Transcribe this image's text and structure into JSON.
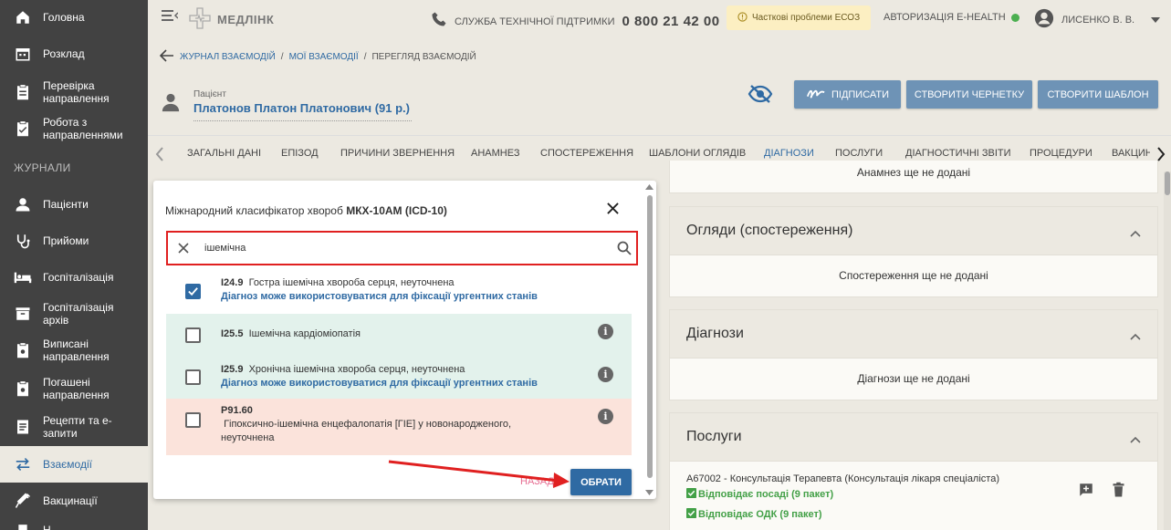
{
  "sidebar": {
    "items": [
      {
        "label": "Головна",
        "icon": "home-icon"
      },
      {
        "label": "Розклад",
        "icon": "calendar-icon"
      },
      {
        "label": "Перевірка направлення",
        "icon": "clipboard-icon"
      },
      {
        "label": "Робота з направленнями",
        "icon": "clipboard-check-icon"
      },
      {
        "label": "Пацієнти",
        "icon": "person-icon"
      },
      {
        "label": "Прийоми",
        "icon": "stethoscope-icon"
      },
      {
        "label": "Госпіталізація",
        "icon": "bed-icon"
      },
      {
        "label": "Госпіталізація архів",
        "icon": "archive-icon"
      },
      {
        "label": "Виписані направлення",
        "icon": "clipboard-icon"
      },
      {
        "label": "Погашені направлення",
        "icon": "clipboard-icon"
      },
      {
        "label": "Рецепти та е-запити",
        "icon": "receipt-icon"
      },
      {
        "label": "Взаємодії",
        "icon": "swap-icon"
      },
      {
        "label": "Вакцинації",
        "icon": "syringe-icon"
      },
      {
        "label": "Н",
        "icon": "document-icon"
      }
    ],
    "section_label": "ЖУРНАЛИ"
  },
  "header": {
    "logo": "МЕДЛІНК",
    "support_label": "СЛУЖБА ТЕХНІЧНОЇ ПІДТРИМКИ",
    "support_phone": "0 800 21 42 00",
    "warning": "Часткові проблеми ЕСОЗ",
    "auth_label": "АВТОРИЗАЦІЯ E-HEALTH",
    "user": "ЛИСЕНКО В. В."
  },
  "breadcrumb": {
    "items": [
      "ЖУРНАЛ ВЗАЄМОДІЙ",
      "МОЇ ВЗАЄМОДІЇ",
      "ПЕРЕГЛЯД ВЗАЄМОДІЙ"
    ],
    "separator": "/"
  },
  "patient": {
    "label": "Пацієнт",
    "name": "Платонов Платон Платонович (91 р.)"
  },
  "actions": {
    "sign": "ПІДПИСАТИ",
    "draft": "СТВОРИТИ ЧЕРНЕТКУ",
    "template": "СТВОРИТИ ШАБЛОН"
  },
  "tabs": [
    "ЗАГАЛЬНІ ДАНІ",
    "ЕПІЗОД",
    "ПРИЧИНИ ЗВЕРНЕННЯ",
    "АНАМНЕЗ",
    "СПОСТЕРЕЖЕННЯ",
    "ШАБЛОНИ ОГЛЯДІВ",
    "ДІАГНОЗИ",
    "ПОСЛУГИ",
    "ДІАГНОСТИЧНІ ЗВІТИ",
    "ПРОЦЕДУРИ",
    "ВАКЦИНАЦІЇ"
  ],
  "active_tab": "ДІАГНОЗИ",
  "modal": {
    "title_prefix": "Міжнародний класифікатор хвороб",
    "title_bold": "МКХ-10АМ (ICD-10)",
    "search_value": "ішемічна",
    "results": [
      {
        "code": "I24.9",
        "text": "Гостра ішемічна хвороба серця, неуточнена",
        "note": "Діагноз може використовуватися для фіксації ургентних станів",
        "checked": true,
        "bg": "#ffffff"
      },
      {
        "code": "I25.5",
        "text": "Ішемічна кардіоміопатія",
        "note": "",
        "checked": false,
        "bg": "#e3f2ec"
      },
      {
        "code": "I25.9",
        "text": "Хронічна ішемічна хвороба серця, неуточнена",
        "note": "Діагноз може використовуватися для фіксації ургентних станів",
        "checked": false,
        "bg": "#e3f2ec"
      },
      {
        "code": "P91.60",
        "text": "Гіпоксично-ішемічна енцефалопатія [ГІЕ] у новонародженого, неуточнена",
        "note": "",
        "checked": false,
        "bg": "#fbe3db"
      }
    ],
    "back": "НАЗАД",
    "choose": "ОБРАТИ"
  },
  "right_panel": {
    "anamnesis_empty": "Анамнез ще не додані",
    "observations": {
      "title": "Огляди (спостереження)",
      "empty": "Спостереження ще не додані"
    },
    "diagnoses": {
      "title": "Діагнози",
      "empty": "Діагнози ще не додані"
    },
    "services": {
      "title": "Послуги",
      "item": "A67002 - Консультація Терапевта (Консультація лікаря спеціаліста)",
      "check1": "Відповідає посаді (9 пакет)",
      "check2": "Відповідає ОДК (9 пакет)"
    }
  },
  "colors": {
    "accent": "#2f6aa3",
    "sidebar": "#424242",
    "highlight": "#e02020",
    "success": "#43a047"
  }
}
